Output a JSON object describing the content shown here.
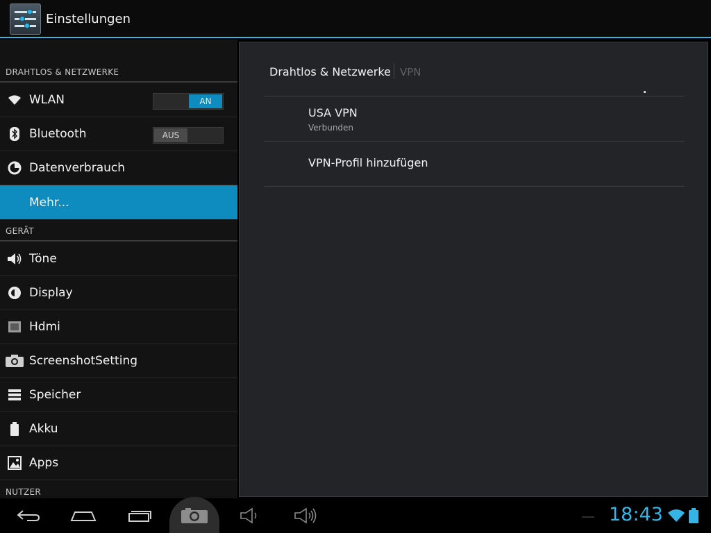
{
  "action_bar": {
    "title": "Einstellungen",
    "icon": "settings-icon",
    "accent": "#33b5e5"
  },
  "sidebar": {
    "sections": [
      {
        "label": "DRAHTLOS & NETZWERKE"
      },
      {
        "label": "GERÄT"
      },
      {
        "label": "NUTZER"
      }
    ],
    "items": [
      {
        "label": "WLAN",
        "icon": "wifi-icon",
        "toggle": "AN"
      },
      {
        "label": "Bluetooth",
        "icon": "bluetooth-icon",
        "toggle": "AUS"
      },
      {
        "label": "Datenverbrauch",
        "icon": "data-usage-icon"
      },
      {
        "label": "Mehr...",
        "selected": true
      },
      {
        "label": "Töne",
        "icon": "speaker-icon"
      },
      {
        "label": "Display",
        "icon": "brightness-icon"
      },
      {
        "label": "Hdmi",
        "icon": "hdmi-icon"
      },
      {
        "label": "ScreenshotSetting",
        "icon": "camera-icon"
      },
      {
        "label": "Speicher",
        "icon": "storage-icon"
      },
      {
        "label": "Akku",
        "icon": "battery-icon"
      },
      {
        "label": "Apps",
        "icon": "apps-icon"
      }
    ],
    "selected_color": "#0e8bbf"
  },
  "detail": {
    "breadcrumb": {
      "parent": "Drahtlos & Netzwerke",
      "current": "VPN"
    },
    "items": [
      {
        "title": "USA VPN",
        "summary": "Verbunden"
      },
      {
        "title": "VPN-Profil hinzufügen"
      }
    ]
  },
  "navbar": {
    "buttons": [
      "back-icon",
      "home-icon",
      "recent-apps-icon",
      "screenshot-icon",
      "volume-down-icon",
      "volume-up-icon"
    ],
    "clock": "18:43",
    "status_icons": [
      "wifi-icon",
      "battery-icon"
    ]
  }
}
